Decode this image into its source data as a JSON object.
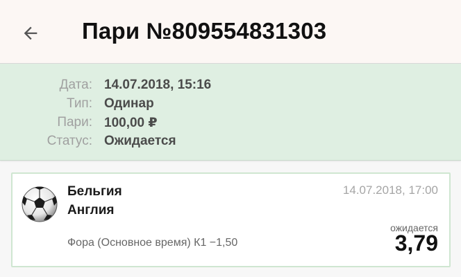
{
  "header": {
    "back_icon": "arrow-left-icon",
    "title": "Пари №809554831303"
  },
  "info": {
    "rows": [
      {
        "label": "Дата:",
        "value": "14.07.2018, 15:16"
      },
      {
        "label": "Тип:",
        "value": "Одинар"
      },
      {
        "label": "Пари:",
        "value": "100,00 ₽"
      },
      {
        "label": "Статус:",
        "value": "Ожидается"
      }
    ]
  },
  "event": {
    "sport_icon": "soccer-ball-icon",
    "team1": "Бельгия",
    "team2": "Англия",
    "date": "14.07.2018, 17:00",
    "market": "Фора (Основное время) К1 −1,50",
    "status": "ожидается",
    "odd": "3,79"
  },
  "colors": {
    "appbar_bg": "#fcf7f4",
    "info_bg": "#dfefe2",
    "card_border": "#cfe6d1"
  }
}
